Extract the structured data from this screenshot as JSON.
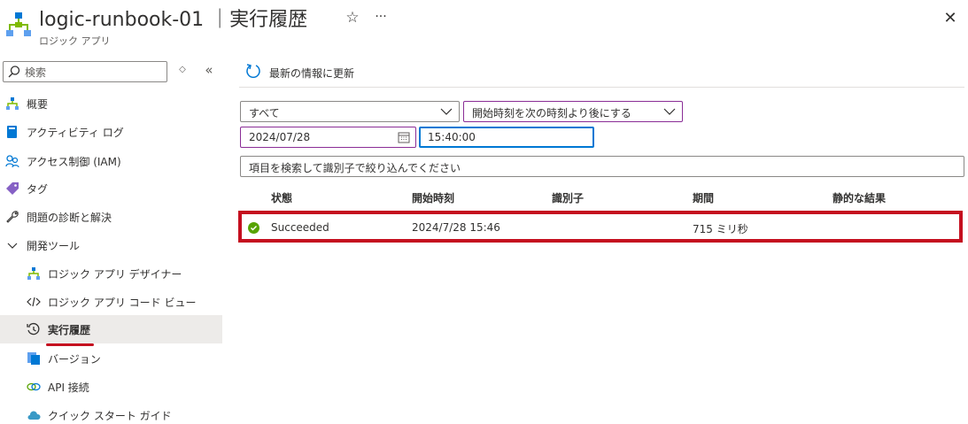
{
  "header": {
    "title": "logic-runbook-01 ｜実行履歴",
    "subtitle": "ロジック アプリ",
    "star_glyph": "☆",
    "more_glyph": "···",
    "close_glyph": "✕"
  },
  "sidebar": {
    "search_placeholder": "検索",
    "updown_glyph": "◇",
    "collapse_glyph": "«",
    "items": [
      {
        "label": "概要",
        "icon": "logic-app-icon"
      },
      {
        "label": "アクティビティ ログ",
        "icon": "activity-log-icon"
      },
      {
        "label": "アクセス制御 (IAM)",
        "icon": "iam-people-icon"
      },
      {
        "label": "タグ",
        "icon": "tag-icon"
      },
      {
        "label": "問題の診断と解決",
        "icon": "wrench-icon"
      },
      {
        "label": "開発ツール",
        "icon": "chevron-down-icon"
      },
      {
        "label": "ロジック アプリ デザイナー",
        "icon": "designer-icon"
      },
      {
        "label": "ロジック アプリ コード ビュー",
        "icon": "code-icon"
      },
      {
        "label": "実行履歴",
        "icon": "history-icon"
      },
      {
        "label": "バージョン",
        "icon": "versions-icon"
      },
      {
        "label": "API 接続",
        "icon": "api-connection-icon"
      },
      {
        "label": "クイック スタート ガイド",
        "icon": "cloud-icon"
      }
    ]
  },
  "toolbar": {
    "refresh_label": "最新の情報に更新"
  },
  "filters": {
    "status_value": "すべて",
    "time_filter_value": "開始時刻を次の時刻より後にする",
    "date_value": "2024/07/28",
    "time_value": "15:40:00",
    "search_placeholder": "項目を検索して識別子で絞り込んでください"
  },
  "table": {
    "columns": [
      "状態",
      "開始時刻",
      "識別子",
      "期間",
      "静的な結果"
    ],
    "rows": [
      {
        "status": "Succeeded",
        "start_time": "2024/7/28 15:46",
        "identifier": "",
        "duration": "715 ミリ秒",
        "static_result": ""
      }
    ]
  },
  "colors": {
    "accent": "#0078d4",
    "highlight": "#c50f1f",
    "success": "#57a300",
    "focus_purple": "#8a2d96"
  }
}
